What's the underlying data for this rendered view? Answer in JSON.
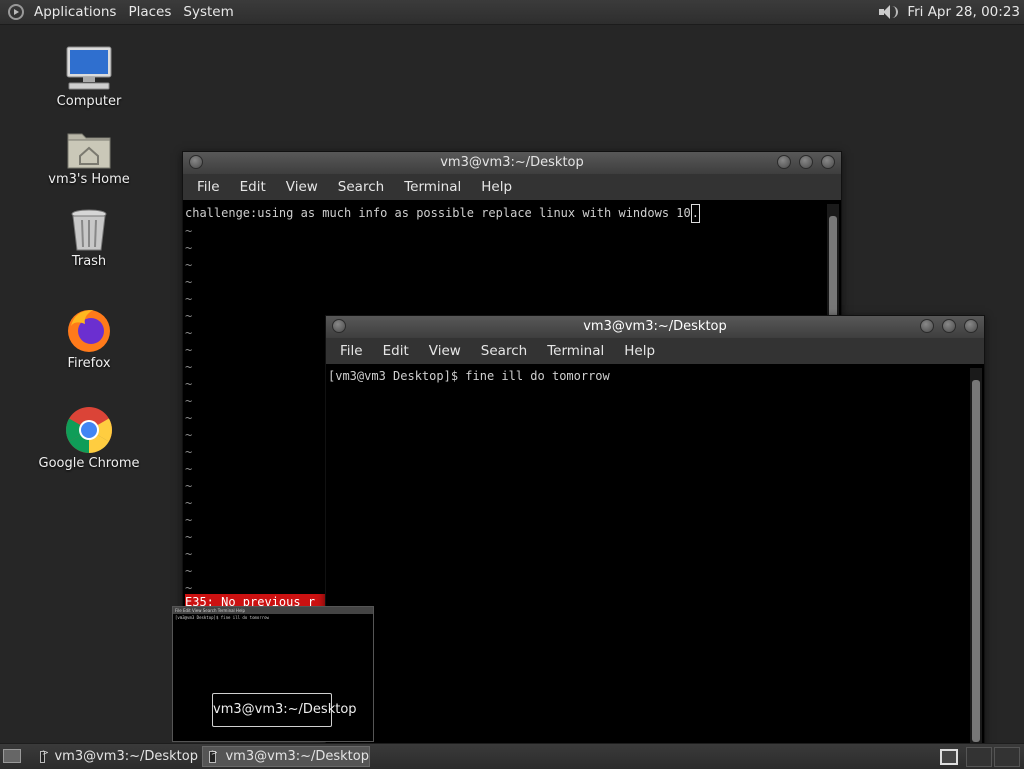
{
  "top_panel": {
    "menus": [
      "Applications",
      "Places",
      "System"
    ],
    "clock": "Fri Apr 28, 00:23"
  },
  "desktop_icons": [
    {
      "label": "Computer",
      "icon": "computer-icon"
    },
    {
      "label": "vm3's Home",
      "icon": "home-folder-icon"
    },
    {
      "label": "Trash",
      "icon": "trash-icon"
    },
    {
      "label": "Firefox",
      "icon": "firefox-icon"
    },
    {
      "label": "Google Chrome",
      "icon": "chrome-icon"
    }
  ],
  "window_back": {
    "title": "vm3@vm3:~/Desktop",
    "menu": [
      "File",
      "Edit",
      "View",
      "Search",
      "Terminal",
      "Help"
    ],
    "line1": "challenge:using as much info as possible replace linux with windows 10",
    "cursor_char": ".",
    "tilde": "~",
    "error": "E35: No previous r"
  },
  "window_front": {
    "title": "vm3@vm3:~/Desktop",
    "menu": [
      "File",
      "Edit",
      "View",
      "Search",
      "Terminal",
      "Help"
    ],
    "prompt_line": "[vm3@vm3 Desktop]$ fine ill do tomorrow"
  },
  "switcher": {
    "thumb_menu": "File  Edit  View  Search  Terminal  Help",
    "thumb_line": "[vm3@vm3 Desktop]$ fine ill do tomorrow",
    "tooltip": "vm3@vm3:~/Desktop"
  },
  "taskbar": {
    "tasks": [
      "vm3@vm3:~/Desktop",
      "vm3@vm3:~/Desktop"
    ]
  },
  "colors": {
    "desktop_bg": "#262626",
    "error_bg": "#cc1111"
  }
}
